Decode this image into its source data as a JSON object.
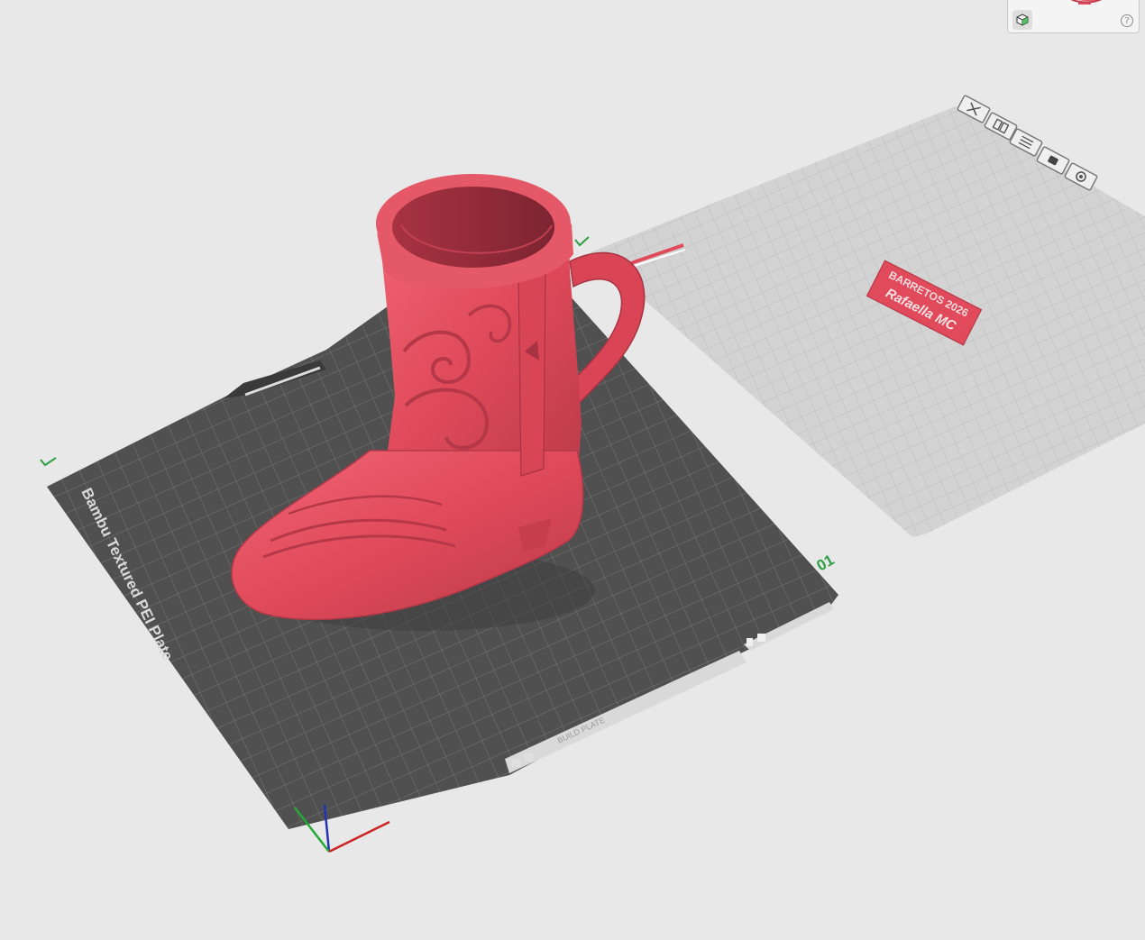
{
  "plate1": {
    "brand_label": "Bambu Textured PEI Plate",
    "plate_number": "01",
    "footer_label": "BUILD PLATE",
    "bed_color": "#505050",
    "grid_color": "#7a7a7a"
  },
  "plate2": {
    "label_line1": "BARRETOS 2026",
    "label_line2": "Rafaella MC",
    "bed_color": "#d3d3d3"
  },
  "model": {
    "name": "cowboy-boot-mug",
    "color": "#e04a5a"
  },
  "preview": {
    "help_label": "?"
  },
  "icons": {
    "plate_toolbar": [
      "close-icon",
      "arrange-icon",
      "orient-icon",
      "lock-icon",
      "settings-icon"
    ],
    "view_cube": "view-cube-icon"
  }
}
